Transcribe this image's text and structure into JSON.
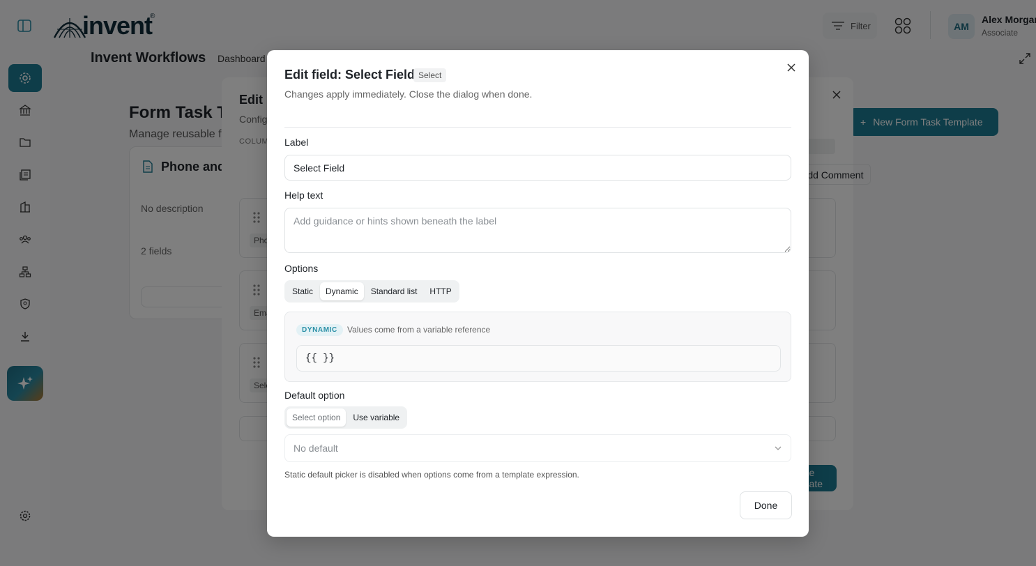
{
  "brand": {
    "logo_text": "invent",
    "registered": "®"
  },
  "header": {
    "filter_label": "Filter",
    "user": {
      "initials": "AM",
      "name": "Alex Morgan",
      "role": "Associate"
    }
  },
  "app": {
    "title": "Invent Workflows",
    "nav_link": "Dashboard"
  },
  "page": {
    "title": "Form Task Templates",
    "subtitle": "Manage reusable form task templates",
    "new_button": "New Form Task Template",
    "card": {
      "title": "Phone and Email",
      "description": "No description",
      "field_count": "2 fields"
    }
  },
  "outer_dialog": {
    "title": "Edit Form Task Template",
    "subtitle": "Configure the form fields",
    "columns_label": "COLUMNS",
    "row_chips": [
      "Phone",
      "Email",
      "Select"
    ],
    "comment_button": "Add Comment",
    "create_button": "Update Template"
  },
  "dialog": {
    "title": "Edit field: Select Field",
    "badge": "Select",
    "subtitle": "Changes apply immediately. Close the dialog when done.",
    "label_label": "Label",
    "label_value": "Select Field",
    "help_label": "Help text",
    "help_placeholder": "Add guidance or hints shown beneath the label",
    "options_label": "Options",
    "option_modes": [
      "Static",
      "Dynamic",
      "Standard list",
      "HTTP"
    ],
    "active_mode": "Dynamic",
    "dynamic": {
      "chip": "DYNAMIC",
      "description": "Values come from a variable reference",
      "value": "{{ }}"
    },
    "default_label": "Default option",
    "default_modes": [
      "Select option",
      "Use variable"
    ],
    "default_select": "No default",
    "hint": "Static default picker is disabled when options come from a template expression.",
    "done_button": "Done"
  },
  "colors": {
    "accent": "#1d7a92",
    "overlay": "rgba(0,0,0,0.5)"
  }
}
